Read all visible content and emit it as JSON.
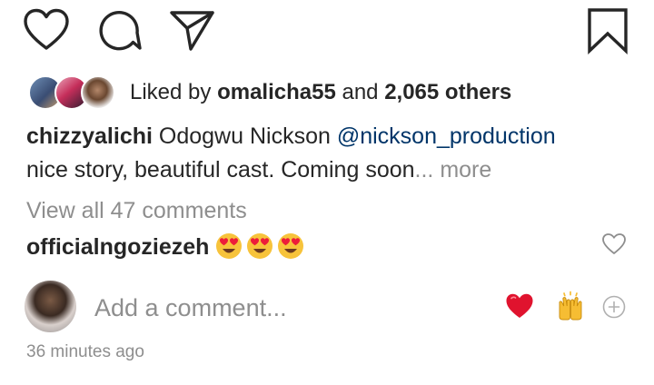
{
  "actions": {
    "like_icon": "heart-outline",
    "comment_icon": "speech-bubble",
    "share_icon": "paper-plane",
    "save_icon": "bookmark"
  },
  "likes": {
    "prefix": "Liked by ",
    "user": "omalicha55",
    "middle": " and ",
    "others": "2,065 others"
  },
  "caption": {
    "username": "chizzyalichi",
    "text_line1": " Odogwu Nickson ",
    "mention": "@nickson_production",
    "text_line2": "nice story, beautiful cast. Coming soon",
    "ellipsis": "...",
    "more": " more"
  },
  "comments": {
    "view_all": "View all 47 comments",
    "top_comment": {
      "username": "officialngoziezeh",
      "emoji": [
        "heart-eyes",
        "heart-eyes",
        "heart-eyes"
      ]
    }
  },
  "composer": {
    "placeholder": "Add a comment...",
    "quick_reactions": [
      "red-heart",
      "raising-hands"
    ]
  },
  "timestamp": "36 minutes ago",
  "colors": {
    "text": "#262626",
    "muted": "#8e8e8e",
    "link": "#003569",
    "heart_red": "#ed1c3a",
    "emoji_yellow": "#f7c33b"
  }
}
